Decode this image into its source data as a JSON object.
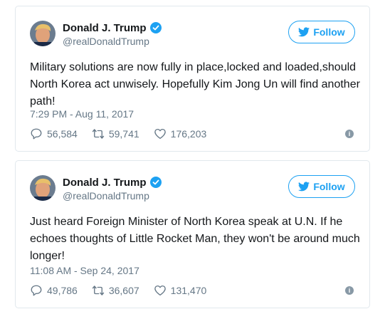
{
  "colors": {
    "accent": "#1da1f2",
    "text": "#14171a",
    "muted": "#657786",
    "border": "#e1e8ed"
  },
  "tweets": [
    {
      "display_name": "Donald J. Trump",
      "handle": "@realDonaldTrump",
      "verified_icon": "verified-badge-icon",
      "follow_label": "Follow",
      "text": "Military solutions are now fully in place,locked and loaded,should North Korea act unwisely. Hopefully Kim Jong Un will find another path!",
      "timestamp": "7:29 PM - Aug 11, 2017",
      "replies": "56,584",
      "retweets": "59,741",
      "likes": "176,203"
    },
    {
      "display_name": "Donald J. Trump",
      "handle": "@realDonaldTrump",
      "verified_icon": "verified-badge-icon",
      "follow_label": "Follow",
      "text": "Just heard Foreign Minister of North Korea speak at U.N. If he echoes thoughts of Little Rocket Man, they won't be around much longer!",
      "timestamp": "11:08 AM - Sep 24, 2017",
      "replies": "49,786",
      "retweets": "36,607",
      "likes": "131,470"
    }
  ]
}
